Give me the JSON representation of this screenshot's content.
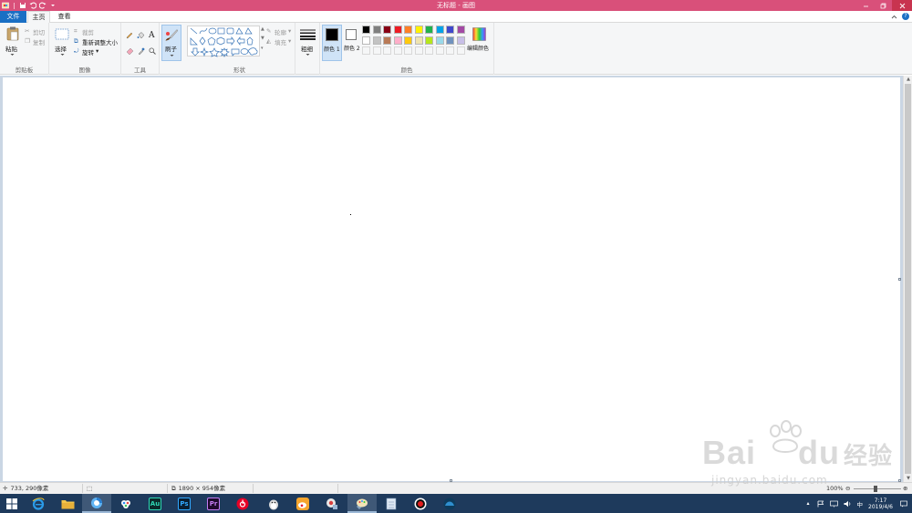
{
  "window": {
    "title": "无标题 - 画图",
    "controls": [
      "minimize",
      "restore",
      "close"
    ]
  },
  "tabs": [
    {
      "label": "文件"
    },
    {
      "label": "主页"
    },
    {
      "label": "查看"
    }
  ],
  "ribbon": {
    "clipboard": {
      "paste": "粘贴",
      "cut": "剪切",
      "copy": "复制",
      "group": "剪贴板"
    },
    "image": {
      "select": "选择",
      "crop": "裁剪",
      "resize": "重新调整大小",
      "rotate": "旋转",
      "group": "图像"
    },
    "tools": {
      "group": "工具",
      "text_tool": "A"
    },
    "brush": {
      "label": "刷子"
    },
    "shapes": {
      "outline": "轮廓",
      "fill": "填充",
      "group": "形状"
    },
    "size": {
      "label": "粗细"
    },
    "colors": {
      "color1": "颜色 1",
      "color2": "颜色 2",
      "edit": "编辑颜色",
      "group": "颜色",
      "color1_value": "#000000",
      "color2_value": "#ffffff",
      "palette_row1": [
        "#000000",
        "#7f7f7f",
        "#880015",
        "#ed1c24",
        "#ff7f27",
        "#fff200",
        "#22b14c",
        "#00a2e8",
        "#3f48cc",
        "#a349a4"
      ],
      "palette_row2": [
        "#ffffff",
        "#c3c3c3",
        "#b97a57",
        "#ffaec9",
        "#ffc90e",
        "#efe4b0",
        "#b5e61d",
        "#99d9ea",
        "#7092be",
        "#c8bfe7"
      ]
    }
  },
  "status": {
    "cursor_pos": "733, 290像素",
    "canvas_size": "1890 × 954像素",
    "zoom": "100%"
  },
  "taskbar": {
    "apps": [
      "start",
      "ie",
      "explorer",
      "browser",
      "baidu-netdisk",
      "audition",
      "photoshop",
      "premiere",
      "netease-music",
      "app-9",
      "weibo",
      "app-11",
      "paint",
      "notepad",
      "recorder",
      "app-15"
    ],
    "audition_label": "Au",
    "photoshop_label": "Ps",
    "premiere_label": "Pr",
    "time": "7:17",
    "date": "2019/4/6"
  },
  "watermark": {
    "brand": "Bai",
    "brand2": "du",
    "cn": "经验",
    "url": "jingyan.baidu.com"
  }
}
